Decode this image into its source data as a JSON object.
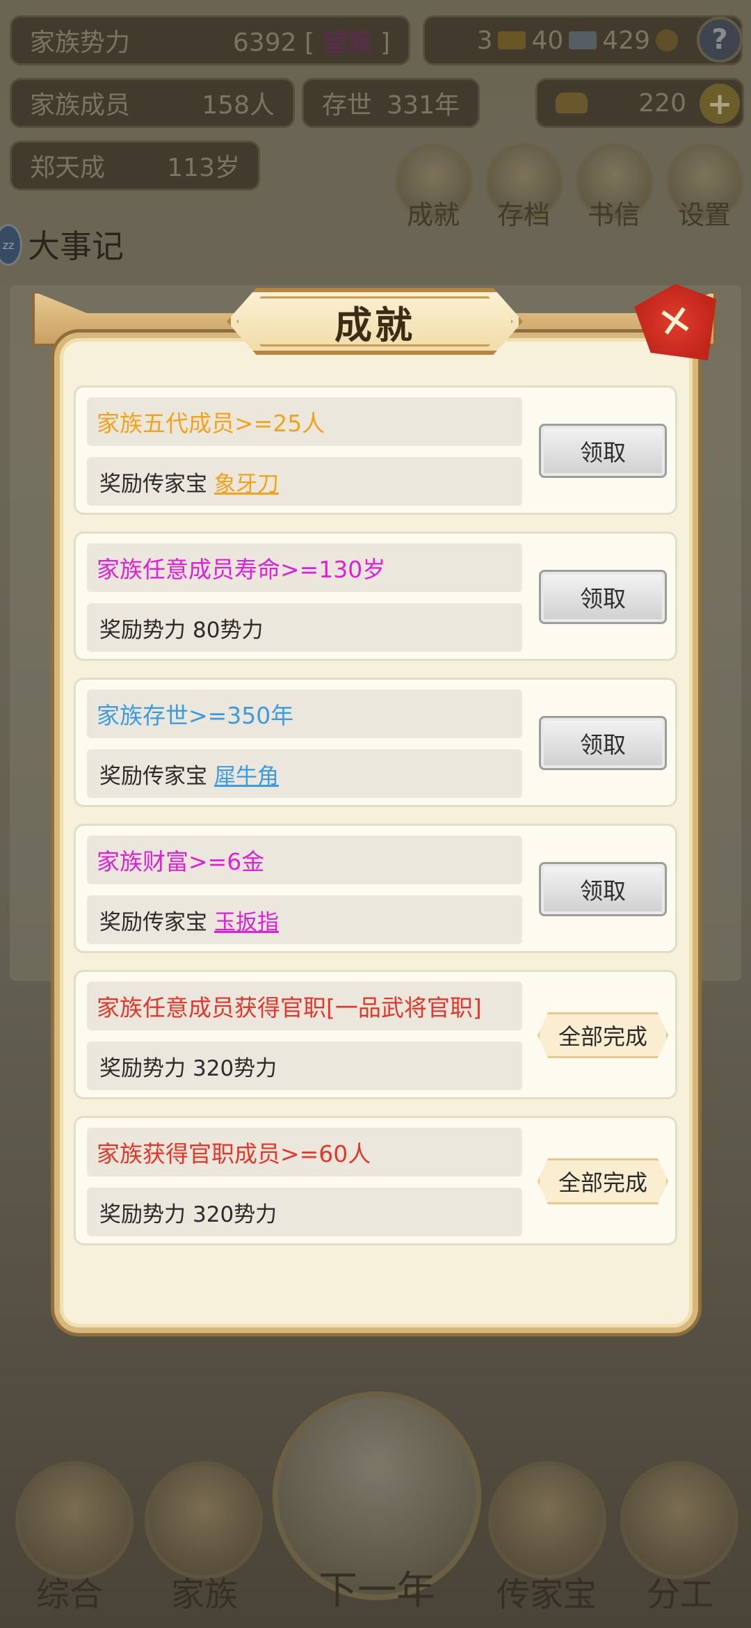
{
  "status": {
    "power_label": "家族势力",
    "power_value": "6392",
    "power_rank_open": "[",
    "power_rank": "望族",
    "power_rank_close": "]",
    "gold_bars": "3",
    "silver_bars": "40",
    "coins": "429",
    "help_icon": "question-icon",
    "members_label": "家族成员",
    "members_value": "158人",
    "existence_label": "存世",
    "existence_value": "331年",
    "ingots": "220",
    "patriarch_name": "郑天成",
    "patriarch_age": "113岁"
  },
  "top_menu": [
    {
      "label": "成就",
      "icon": "achievement-icon"
    },
    {
      "label": "存档",
      "icon": "save-icon"
    },
    {
      "label": "书信",
      "icon": "letter-icon"
    },
    {
      "label": "设置",
      "icon": "settings-icon"
    }
  ],
  "events": {
    "title": "大事记",
    "badge": "zz"
  },
  "dialog": {
    "title": "成就",
    "close_icon": "close-icon",
    "achievements": [
      {
        "condition": "家族五代成员>=25人",
        "condition_color": "#f2a31b",
        "reward_prefix": "奖励传家宝",
        "reward_item": "象牙刀",
        "item_color": "#f2a31b",
        "action": "领取",
        "state": "claim"
      },
      {
        "condition": "家族任意成员寿命>=130岁",
        "condition_color": "#e01fd6",
        "reward_prefix": "奖励势力",
        "reward_item": "80势力",
        "item_color": "#2b2b2b",
        "action": "领取",
        "state": "claim"
      },
      {
        "condition": "家族存世>=350年",
        "condition_color": "#3a9be0",
        "reward_prefix": "奖励传家宝",
        "reward_item": "犀牛角",
        "item_color": "#3a9be0",
        "action": "领取",
        "state": "claim"
      },
      {
        "condition": "家族财富>=6金",
        "condition_color": "#e01fd6",
        "reward_prefix": "奖励传家宝",
        "reward_item": "玉扳指",
        "item_color": "#e01fd6",
        "action": "领取",
        "state": "claim"
      },
      {
        "condition": "家族任意成员获得官职[一品武将官职]",
        "condition_color": "#e5362a",
        "reward_prefix": "奖励势力",
        "reward_item": "320势力",
        "item_color": "#2b2b2b",
        "action": "全部完成",
        "state": "done"
      },
      {
        "condition": "家族获得官职成员>=60人",
        "condition_color": "#e5362a",
        "reward_prefix": "奖励势力",
        "reward_item": "320势力",
        "item_color": "#2b2b2b",
        "action": "全部完成",
        "state": "done"
      }
    ]
  },
  "bottom_nav": [
    {
      "label": "综合",
      "icon": "scroll-icon"
    },
    {
      "label": "家族",
      "icon": "house-icon"
    },
    {
      "label": "下一年",
      "icon": "mountain-icon"
    },
    {
      "label": "传家宝",
      "icon": "treasure-icon"
    },
    {
      "label": "分工",
      "icon": "people-icon"
    }
  ]
}
